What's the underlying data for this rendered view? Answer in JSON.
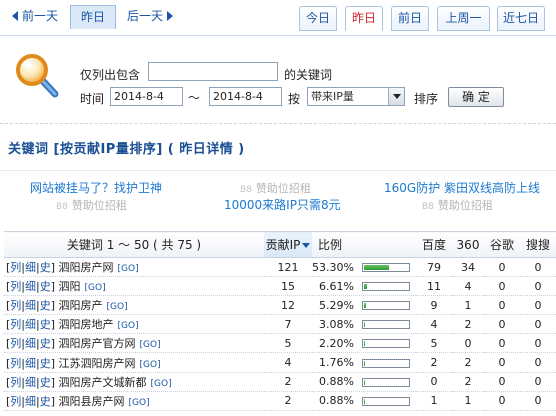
{
  "nav": {
    "prev_label": "前一天",
    "current_label": "昨日",
    "next_label": "后一天"
  },
  "quick": {
    "today": "今日",
    "yesterday": "昨日",
    "day_before": "前日",
    "last_week": "上周一",
    "last_7_days": "近七日"
  },
  "filter": {
    "include_label": "仅列出包含",
    "keyword_suffix": "的关键词",
    "keyword_value": "",
    "time_label": "时间",
    "date_from": "2014-8-4",
    "date_sep": "～",
    "date_to": "2014-8-4",
    "by_label": "按",
    "sort_selected": "带来IP量",
    "sort_label": "排序",
    "confirm_label": "确 定"
  },
  "section": {
    "title": "关键词 [按贡献IP量排序] ( 昨日详情 )"
  },
  "ads": {
    "a1": "网站被挂马了？找护卫神",
    "a2_badge": "B8",
    "a2": "赞助位招租",
    "a3": "160G防护 紫田双线高防上线",
    "a4_badge": "B8",
    "a4": "赞助位招租",
    "a5": "10000来路IP只需8元",
    "a6_badge": "B8",
    "a6": "赞助位招租"
  },
  "table": {
    "columns": {
      "keyword": "关键词 1 ～ 50 ( 共 75 )",
      "ip": "贡献IP",
      "ratio": "比例",
      "baidu": "百度",
      "s360": "360",
      "google": "谷歌",
      "sogou": "搜搜"
    },
    "link_labels": {
      "list": "列",
      "detail": "细",
      "history": "史"
    },
    "go_label": "[GO]",
    "rows": [
      {
        "keyword": "泗阳房产网",
        "ip": "121",
        "ratio": "53.30%",
        "share": 0.533,
        "baidu": "79",
        "s360": "34",
        "google": "0",
        "sogou": "0"
      },
      {
        "keyword": "泗阳",
        "ip": "15",
        "ratio": "6.61%",
        "share": 0.0661,
        "baidu": "11",
        "s360": "4",
        "google": "0",
        "sogou": "0"
      },
      {
        "keyword": "泗阳房产",
        "ip": "12",
        "ratio": "5.29%",
        "share": 0.0529,
        "baidu": "9",
        "s360": "1",
        "google": "0",
        "sogou": "0"
      },
      {
        "keyword": "泗阳房地产",
        "ip": "7",
        "ratio": "3.08%",
        "share": 0.0308,
        "baidu": "4",
        "s360": "2",
        "google": "0",
        "sogou": "0"
      },
      {
        "keyword": "泗阳房产官方网",
        "ip": "5",
        "ratio": "2.20%",
        "share": 0.022,
        "baidu": "5",
        "s360": "0",
        "google": "0",
        "sogou": "0"
      },
      {
        "keyword": "江苏泗阳房产网",
        "ip": "4",
        "ratio": "1.76%",
        "share": 0.0176,
        "baidu": "2",
        "s360": "2",
        "google": "0",
        "sogou": "0"
      },
      {
        "keyword": "泗阳房产文城新都",
        "ip": "2",
        "ratio": "0.88%",
        "share": 0.0088,
        "baidu": "0",
        "s360": "2",
        "google": "0",
        "sogou": "0"
      },
      {
        "keyword": "泗阳县房产网",
        "ip": "2",
        "ratio": "0.88%",
        "share": 0.0088,
        "baidu": "1",
        "s360": "1",
        "google": "0",
        "sogou": "0"
      }
    ]
  },
  "colors": {
    "link_blue": "#1b56a6",
    "ad_blue": "#1b79d1",
    "active_red": "#d0242b",
    "bar_green": "#2f9a2f"
  }
}
